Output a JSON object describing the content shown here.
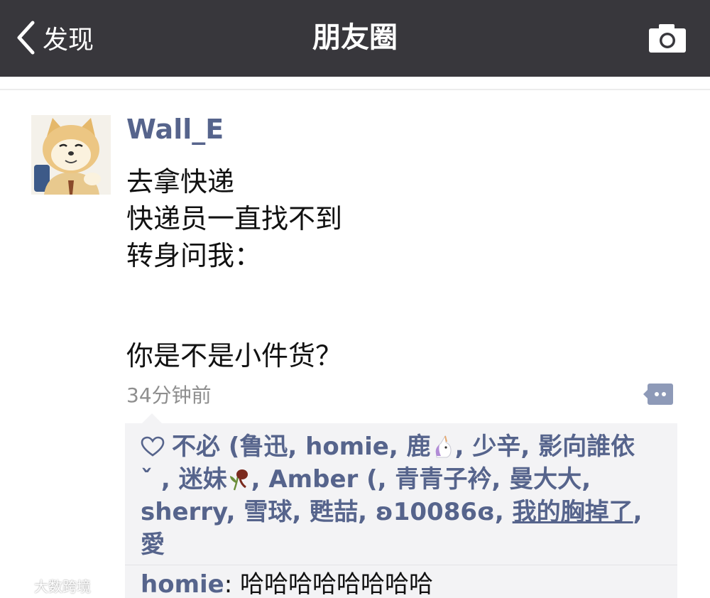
{
  "navbar": {
    "back_label": "发现",
    "title": "朋友圈"
  },
  "post": {
    "author": "Wall_E",
    "lines": [
      "去拿快递",
      "快递员一直找不到",
      "转身问我：",
      "你是不是小件货？"
    ],
    "time": "34分钟前"
  },
  "likes": {
    "names": [
      "不必 (鲁迅",
      "homie",
      "鹿",
      "少辛",
      "影向誰依",
      "ˇ",
      "迷妹",
      "Amber (",
      "青青子衿",
      "曼大大",
      "sherry",
      "雪球",
      "甦喆",
      "ʚ10086ɞ",
      "我的胸掉了",
      "愛"
    ]
  },
  "comments": [
    {
      "user": "homie",
      "text": "哈哈哈哈哈哈哈哈"
    }
  ],
  "watermark": "大数跨境"
}
